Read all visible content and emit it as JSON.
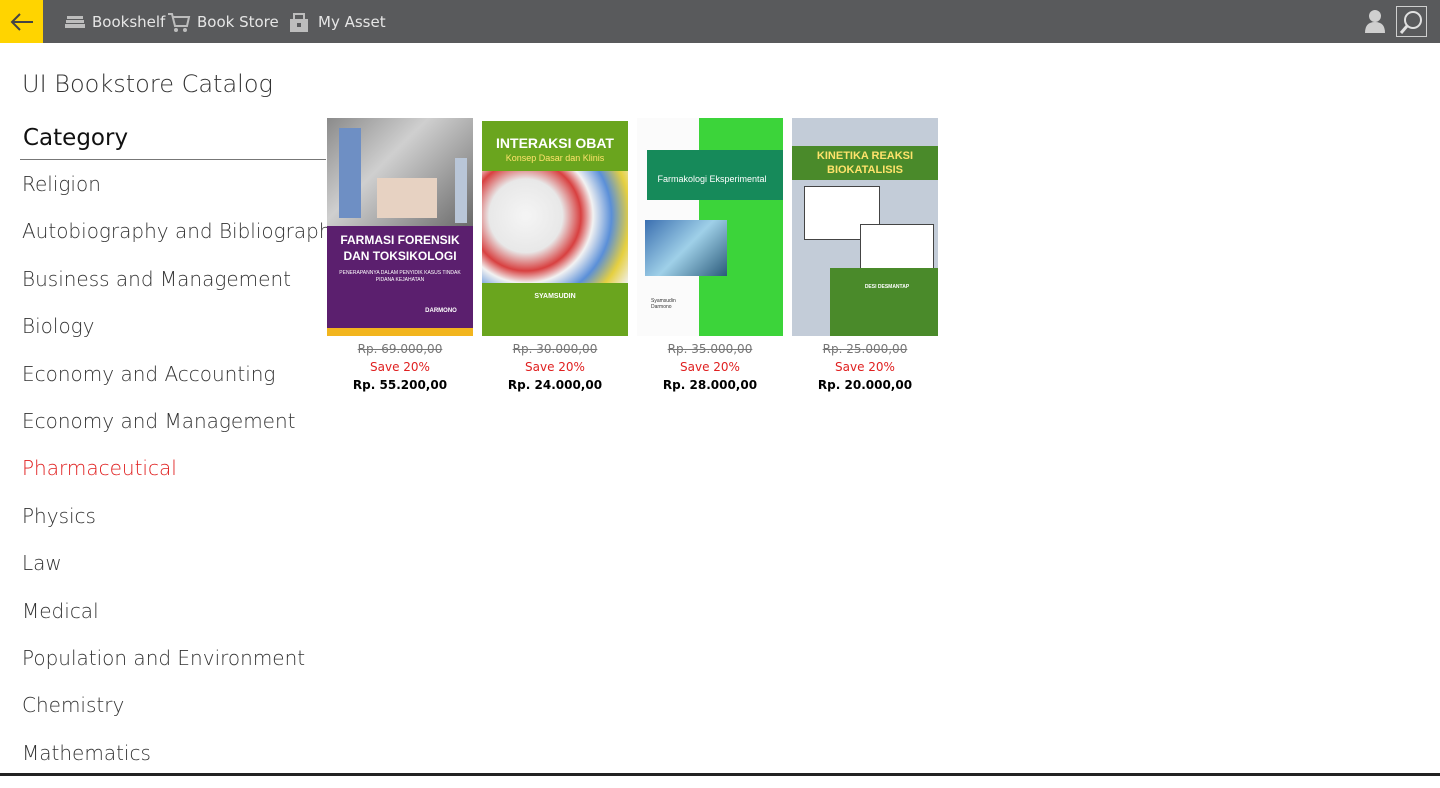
{
  "nav": {
    "items": [
      {
        "label": "Bookshelf",
        "icon": "bookshelf-icon"
      },
      {
        "label": "Book Store",
        "icon": "cart-icon"
      },
      {
        "label": "My Asset",
        "icon": "asset-icon"
      }
    ],
    "back_icon": "back-arrow-icon",
    "user_icon": "user-icon",
    "search_icon": "search-icon"
  },
  "page": {
    "title": "UI Bookstore Catalog"
  },
  "category": {
    "header": "Category",
    "items": [
      "Religion",
      "Autobiography and Bibliography",
      "Business and Management",
      "Biology",
      "Economy and Accounting",
      "Economy and Management",
      "Pharmaceutical",
      "Physics",
      "Law",
      "Medical",
      "Population and Environment",
      "Chemistry",
      "Mathematics"
    ],
    "active": "Pharmaceutical"
  },
  "books": [
    {
      "cover_title": "FARMASI FORENSIK DAN TOKSIKOLOGI",
      "cover_subtitle": "PENERAPANNYA DALAM PENYIDIK KASUS TINDAK PIDANA KEJAHATAN",
      "cover_author": "DARMONO",
      "price_old": "Rp. 69.000,00",
      "save": "Save 20%",
      "price_new": "Rp. 55.200,00"
    },
    {
      "cover_title": "INTERAKSI OBAT",
      "cover_subtitle": "Konsep Dasar dan Klinis",
      "cover_author": "SYAMSUDIN",
      "price_old": "Rp. 30.000,00",
      "save": "Save 20%",
      "price_new": "Rp. 24.000,00"
    },
    {
      "cover_title": "Farmakologi Eksperimental",
      "cover_subtitle": "",
      "cover_author": "Syamsudin Darmono",
      "price_old": "Rp. 35.000,00",
      "save": "Save 20%",
      "price_new": "Rp. 28.000,00"
    },
    {
      "cover_title": "KINETIKA REAKSI BIOKATALISIS",
      "cover_subtitle": "",
      "cover_author": "DESI DESMANTAP",
      "price_old": "Rp. 25.000,00",
      "save": "Save 20%",
      "price_new": "Rp. 20.000,00"
    }
  ],
  "colors": {
    "topbar": "#595a5c",
    "accent": "#ffd400",
    "active_category": "#e02020",
    "save_text": "#e02020"
  }
}
